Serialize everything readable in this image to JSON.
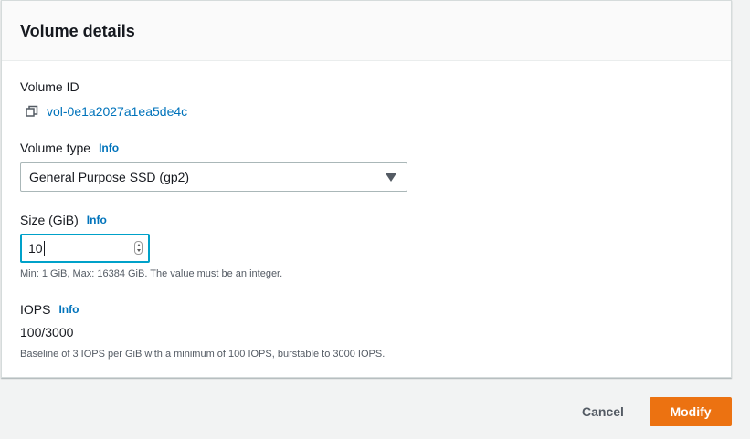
{
  "panel": {
    "title": "Volume details"
  },
  "volume_id": {
    "label": "Volume ID",
    "value": "vol-0e1a2027a1ea5de4c",
    "copy_icon": "copy-icon"
  },
  "volume_type": {
    "label": "Volume type",
    "info": "Info",
    "selected": "General Purpose SSD (gp2)",
    "dropdown_icon": "caret-down-icon"
  },
  "size": {
    "label": "Size (GiB)",
    "info": "Info",
    "value": "10",
    "hint": "Min: 1 GiB, Max: 16384 GiB. The value must be an integer."
  },
  "iops": {
    "label": "IOPS",
    "info": "Info",
    "value": "100/3000",
    "hint": "Baseline of 3 IOPS per GiB with a minimum of 100 IOPS, burstable to 3000 IOPS."
  },
  "actions": {
    "cancel_label": "Cancel",
    "modify_label": "Modify"
  },
  "colors": {
    "link": "#0073bb",
    "primary_button": "#ec7211",
    "focus_border": "#00a1c9"
  }
}
